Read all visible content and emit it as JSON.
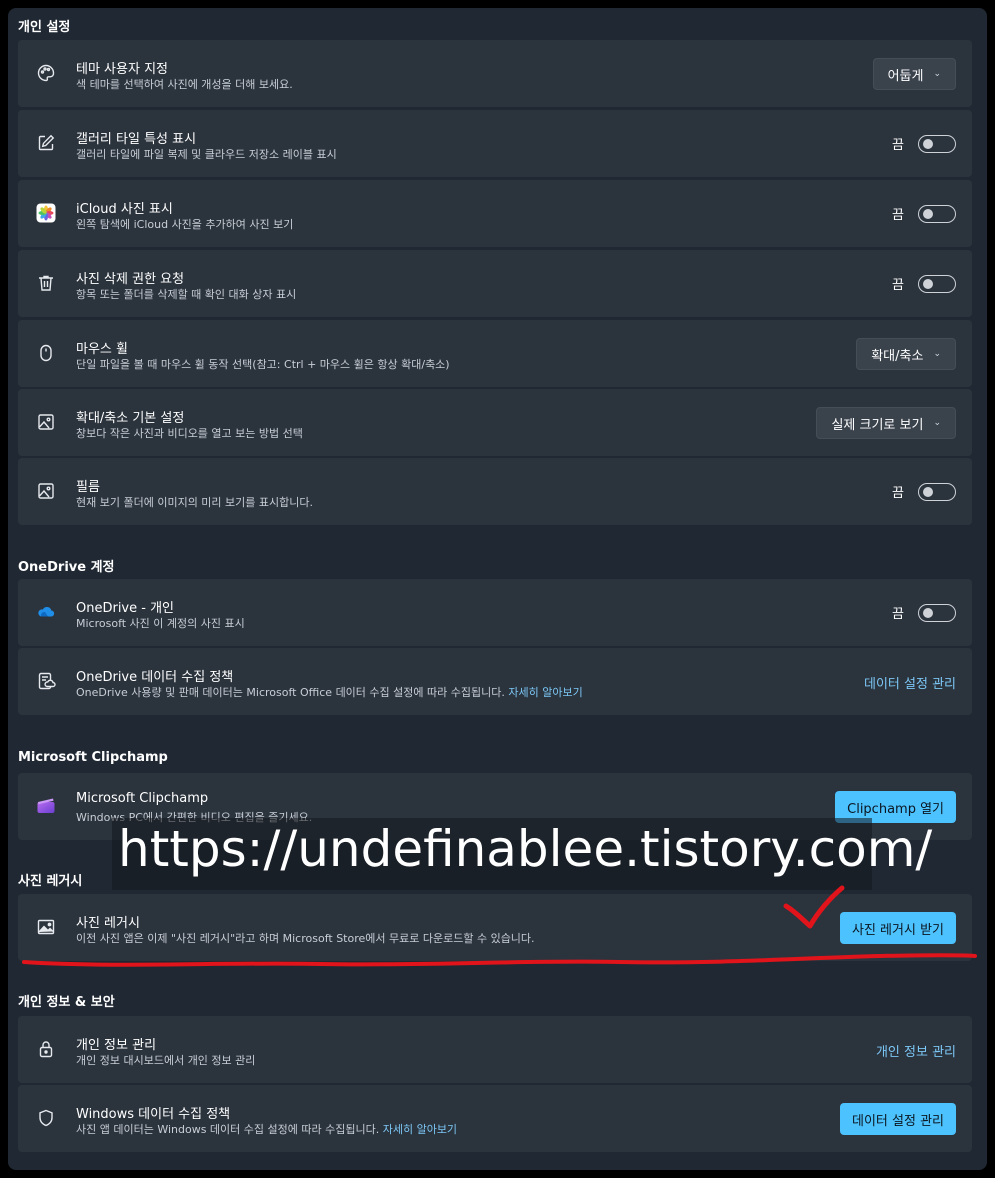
{
  "sections": {
    "personal": {
      "title": "개인 설정",
      "items": [
        {
          "title": "테마 사용자 지정",
          "desc": "색 테마를 선택하여 사진에 개성을 더해 보세요.",
          "control": "어둡게"
        },
        {
          "title": "갤러리 타일 특성 표시",
          "desc": "갤러리 타일에 파일 복제 및 클라우드 저장소 레이블 표시",
          "state": "끔"
        },
        {
          "title": "iCloud 사진 표시",
          "desc": "왼쪽 탐색에 iCloud 사진을 추가하여 사진 보기",
          "state": "끔"
        },
        {
          "title": "사진 삭제 권한 요청",
          "desc": "항목 또는 폴더를 삭제할 때 확인 대화 상자 표시",
          "state": "끔"
        },
        {
          "title": "마우스 휠",
          "desc": "단일 파일을 볼 때 마우스 휠 동작 선택(참고: Ctrl + 마우스 휠은 항상 확대/축소)",
          "control": "확대/축소"
        },
        {
          "title": "확대/축소 기본 설정",
          "desc": "창보다 작은 사진과 비디오를 열고 보는 방법 선택",
          "control": "실제 크기로 보기"
        },
        {
          "title": "필름",
          "desc": "현재 보기 폴더에 이미지의 미리 보기를 표시합니다.",
          "state": "끔"
        }
      ]
    },
    "onedrive": {
      "title": "OneDrive 계정",
      "items": [
        {
          "title": "OneDrive - 개인",
          "desc": "Microsoft 사진 이 계정의 사진 표시",
          "state": "끔"
        },
        {
          "title": "OneDrive 데이터 수집 정책",
          "desc": "OneDrive 사용량 및 판매 데이터는 Microsoft Office 데이터 수집 설정에 따라 수집됩니다.",
          "desc_link": "자세히 알아보기",
          "action": "데이터 설정 관리"
        }
      ]
    },
    "clipchamp": {
      "title": "Microsoft Clipchamp",
      "items": [
        {
          "title": "Microsoft Clipchamp",
          "desc": "Windows PC에서 간편한 비디오 편집을 즐기세요.",
          "button": "Clipchamp 열기"
        }
      ]
    },
    "legacy": {
      "title": "사진 레거시",
      "items": [
        {
          "title": "사진 레거시",
          "desc": "이전 사진 앱은 이제 \"사진 레거시\"라고 하며 Microsoft Store에서 무료로 다운로드할 수 있습니다.",
          "button": "사진 레거시 받기"
        }
      ]
    },
    "privacy": {
      "title": "개인 정보 & 보안",
      "items": [
        {
          "title": "개인 정보 관리",
          "desc": "개인 정보 대시보드에서 개인 정보 관리",
          "action": "개인 정보 관리"
        },
        {
          "title": "Windows 데이터 수집 정책",
          "desc": "사진 앱 데이터는 Windows 데이터 수집 설정에 따라 수집됩니다.",
          "desc_link": "자세히 알아보기",
          "button": "데이터 설정 관리"
        }
      ]
    }
  },
  "watermark": "https://undefinablee.tistory.com/",
  "colors": {
    "accent": "#4cc2ff",
    "link": "#7cc7f5",
    "annotation": "#e0141a"
  }
}
